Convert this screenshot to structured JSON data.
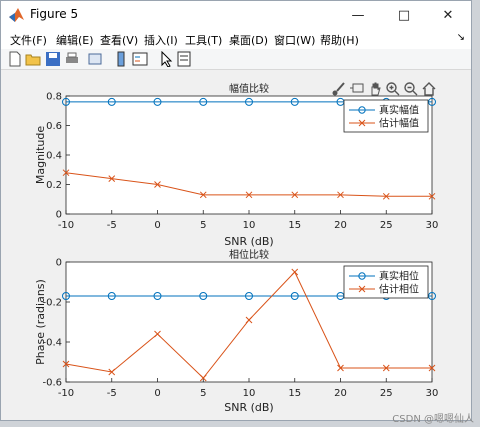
{
  "window": {
    "title": "Figure 5"
  },
  "menu": [
    "文件(F)",
    "编辑(E)",
    "查看(V)",
    "插入(I)",
    "工具(T)",
    "桌面(D)",
    "窗口(W)",
    "帮助(H)"
  ],
  "toolbar_icons": [
    "new-file-icon",
    "open-file-icon",
    "save-icon",
    "print-icon",
    "link-icon",
    "colorbar-icon",
    "legend-icon",
    "select-arrow-icon",
    "property-icon"
  ],
  "axes_toolbar_icons": [
    "brush-icon",
    "data-tips-icon",
    "pan-icon",
    "zoom-in-icon",
    "zoom-out-icon",
    "home-icon"
  ],
  "watermark": "CSDN @嗯嗯仙人",
  "colors": {
    "series_true": "#0072BD",
    "series_est": "#D95319"
  },
  "chart_data": [
    {
      "type": "line",
      "title": "幅值比较",
      "xlabel": "SNR (dB)",
      "ylabel": "Magnitude",
      "x": [
        -10,
        -5,
        0,
        5,
        10,
        15,
        20,
        25,
        30
      ],
      "xlim": [
        -10,
        30
      ],
      "ylim": [
        0,
        0.8
      ],
      "xticks": [
        "-10",
        "-5",
        "0",
        "5",
        "10",
        "15",
        "20",
        "25",
        "30"
      ],
      "yticks": [
        "0",
        "0.2",
        "0.4",
        "0.6",
        "0.8"
      ],
      "yticks_values": [
        0,
        0.2,
        0.4,
        0.6,
        0.8
      ],
      "legend": "top-right",
      "grid": false,
      "series": [
        {
          "name": "真实幅值",
          "marker": "o",
          "values": [
            0.76,
            0.76,
            0.76,
            0.76,
            0.76,
            0.76,
            0.76,
            0.76,
            0.76
          ]
        },
        {
          "name": "估计幅值",
          "marker": "x",
          "values": [
            0.28,
            0.24,
            0.2,
            0.13,
            0.13,
            0.13,
            0.13,
            0.12,
            0.12
          ]
        }
      ]
    },
    {
      "type": "line",
      "title": "相位比较",
      "xlabel": "SNR (dB)",
      "ylabel": "Phase (radians)",
      "x": [
        -10,
        -5,
        0,
        5,
        10,
        15,
        20,
        25,
        30
      ],
      "xlim": [
        -10,
        30
      ],
      "ylim": [
        -0.6,
        0
      ],
      "xticks": [
        "-10",
        "-5",
        "0",
        "5",
        "10",
        "15",
        "20",
        "25",
        "30"
      ],
      "yticks": [
        "-0.6",
        "-0.4",
        "-0.2",
        "0"
      ],
      "yticks_values": [
        -0.6,
        -0.4,
        -0.2,
        0
      ],
      "legend": "top-right",
      "grid": false,
      "series": [
        {
          "name": "真实相位",
          "marker": "o",
          "values": [
            -0.17,
            -0.17,
            -0.17,
            -0.17,
            -0.17,
            -0.17,
            -0.17,
            -0.17,
            -0.17
          ]
        },
        {
          "name": "估计相位",
          "marker": "x",
          "values": [
            -0.51,
            -0.55,
            -0.36,
            -0.58,
            -0.29,
            -0.05,
            -0.53,
            -0.53,
            -0.53
          ]
        }
      ]
    }
  ]
}
